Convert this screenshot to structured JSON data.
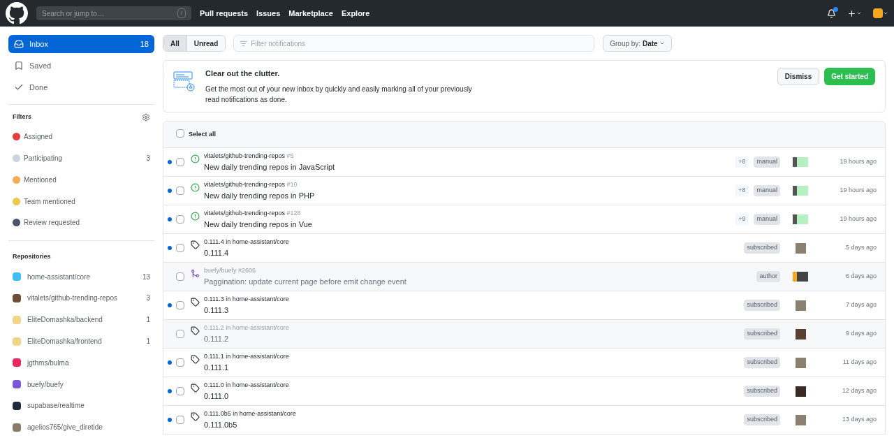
{
  "header": {
    "search_placeholder": "Search or jump to…",
    "search_key": "/",
    "nav": [
      "Pull requests",
      "Issues",
      "Marketplace",
      "Explore"
    ],
    "notifications_unread": true
  },
  "sidebar": {
    "items": [
      {
        "label": "Inbox",
        "count": "18",
        "selected": true
      },
      {
        "label": "Saved",
        "selected": false
      },
      {
        "label": "Done",
        "selected": false
      }
    ],
    "filters_title": "Filters",
    "filters": [
      {
        "label": "Assigned"
      },
      {
        "label": "Participating",
        "count": "3"
      },
      {
        "label": "Mentioned"
      },
      {
        "label": "Team mentioned"
      },
      {
        "label": "Review requested"
      }
    ],
    "repositories_title": "Repositories",
    "repositories": [
      {
        "name": "home-assistant/core",
        "count": "13"
      },
      {
        "name": "vitalets/github-trending-repos",
        "count": "3"
      },
      {
        "name": "EliteDomashka/backend",
        "count": "1"
      },
      {
        "name": "EliteDomashka/frontend",
        "count": "1"
      },
      {
        "name": "jgthms/bulma"
      },
      {
        "name": "buefy/buefy"
      },
      {
        "name": "supabase/realtime"
      },
      {
        "name": "agelios765/give_diretide"
      }
    ]
  },
  "toolbar": {
    "tabs": [
      {
        "label": "All",
        "selected": true
      },
      {
        "label": "Unread",
        "selected": false
      }
    ],
    "filter_placeholder": "Filter notifications",
    "group_by_label": "Group by:",
    "group_by_value": "Date"
  },
  "banner": {
    "title": "Clear out the clutter.",
    "text": "Get the most out of your new inbox by quickly and easily marking all of your previously read notifications as done.",
    "buttons": [
      "Dismiss",
      "Get started"
    ]
  },
  "list": {
    "select_all": "Select all",
    "select_all_checked": false,
    "rows": [
      {
        "kind": "issue",
        "unread": true,
        "repo": "vitalets/github-trending-repos",
        "number": "#5",
        "title": "New daily trending repos in JavaScript",
        "extra": "+8",
        "reason": "manual",
        "time": "19 hours ago"
      },
      {
        "kind": "issue",
        "unread": true,
        "repo": "vitalets/github-trending-repos",
        "number": "#10",
        "title": "New daily trending repos in PHP",
        "extra": "+8",
        "reason": "manual",
        "time": "19 hours ago"
      },
      {
        "kind": "issue",
        "unread": true,
        "repo": "vitalets/github-trending-repos",
        "number": "#128",
        "title": "New daily trending repos in Vue",
        "extra": "+9",
        "reason": "manual",
        "time": "19 hours ago"
      },
      {
        "kind": "release",
        "unread": true,
        "repo": "0.111.4 in home-assistant/core",
        "title": "0.111.4",
        "reason": "subscribed",
        "time": "5 days ago"
      },
      {
        "kind": "pr",
        "unread": false,
        "repo": "buefy/buefy",
        "number": "#2606",
        "title": "Paggination: update current page before emit change event",
        "reason": "author",
        "time": "6 days ago"
      },
      {
        "kind": "release",
        "unread": true,
        "repo": "0.111.3 in home-assistant/core",
        "title": "0.111.3",
        "reason": "subscribed",
        "time": "7 days ago"
      },
      {
        "kind": "release",
        "unread": false,
        "repo": "0.111.2 in home-assistant/core",
        "title": "0.111.2",
        "reason": "subscribed",
        "time": "9 days ago"
      },
      {
        "kind": "release",
        "unread": true,
        "repo": "0.111.1 in home-assistant/core",
        "title": "0.111.1",
        "reason": "subscribed",
        "time": "11 days ago"
      },
      {
        "kind": "release",
        "unread": true,
        "repo": "0.111.0 in home-assistant/core",
        "title": "0.111.0",
        "reason": "subscribed",
        "time": "12 days ago"
      },
      {
        "kind": "release",
        "unread": true,
        "repo": "0.111.0b5 in home-assistant/core",
        "title": "0.111.0b5",
        "reason": "subscribed",
        "time": "13 days ago"
      }
    ]
  }
}
